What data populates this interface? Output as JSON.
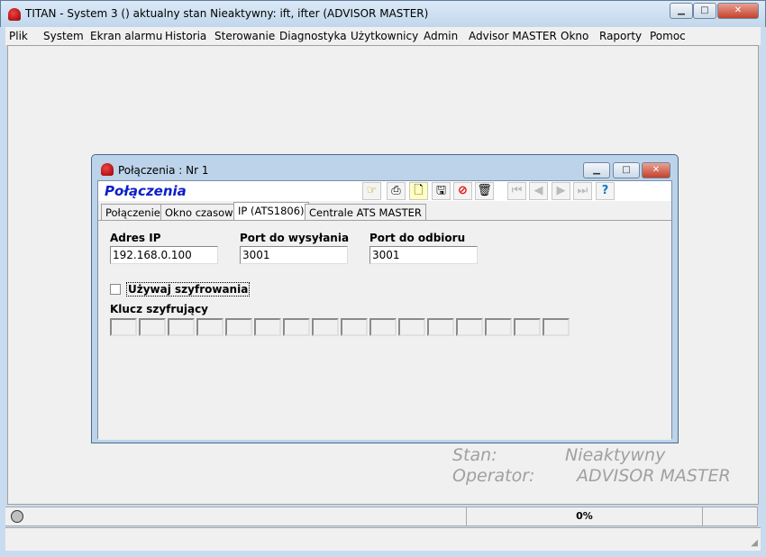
{
  "app": {
    "title": "TITAN - System 3 () aktualny stan Nieaktywny: ift, ifter (ADVISOR MASTER)"
  },
  "menu": [
    "Plik",
    "System",
    "Ekran alarmu",
    "Historia",
    "Sterowanie",
    "Diagnostyka",
    "Użytkownicy",
    "Admin",
    "Advisor MASTER",
    "Okno",
    "Raporty",
    "Pomoc"
  ],
  "child": {
    "title": "Połączenia :  Nr 1",
    "header": "Połączenia",
    "toolbar": [
      "folder-pointer-icon",
      "print-icon",
      "new-document-icon",
      "save-icon",
      "cancel-icon",
      "trash-icon",
      "first-record-icon",
      "previous-record-icon",
      "next-record-icon",
      "last-record-icon",
      "help-icon"
    ],
    "tabs": [
      {
        "label": "Połączenie",
        "selected": false
      },
      {
        "label": "Okno czasowe",
        "selected": false
      },
      {
        "label": "IP (ATS1806)",
        "selected": true
      },
      {
        "label": "Centrale ATS MASTER",
        "selected": false
      }
    ],
    "form": {
      "ip_label": "Adres IP",
      "ip_value": "192.168.0.100",
      "send_label": "Port do wysyłania",
      "send_value": "3001",
      "recv_label": "Port do odbioru",
      "recv_value": "3001",
      "encrypt_label": "Używaj szyfrowania",
      "encrypt_checked": false,
      "key_label": "Klucz szyfrujący",
      "key_fields": [
        "",
        "",
        "",
        "",
        "",
        "",
        "",
        "",
        "",
        "",
        "",
        "",
        "",
        "",
        "",
        ""
      ]
    }
  },
  "info": {
    "state_label": "Stan:",
    "state_value": "Nieaktywny",
    "operator_label": "Operator:",
    "operator_value": "ADVISOR MASTER"
  },
  "status": {
    "progress": "0%"
  }
}
